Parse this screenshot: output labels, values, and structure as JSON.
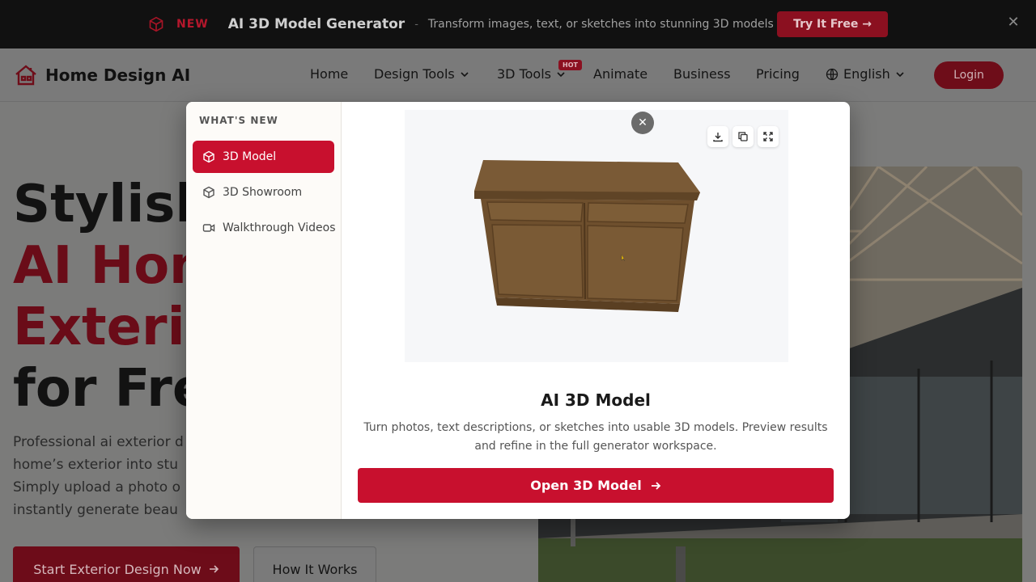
{
  "banner": {
    "new_label": "NEW",
    "title": "AI 3D Model Generator",
    "separator": "-",
    "description": "Transform images, text, or sketches into stunning 3D models",
    "cta": "Try It Free →",
    "close": "✕"
  },
  "nav": {
    "brand": "Home Design AI",
    "items": [
      "Home",
      "Design Tools",
      "3D Tools",
      "Animate",
      "Business",
      "Pricing"
    ],
    "hot_badge": "HOT",
    "language": "English",
    "login": "Login"
  },
  "hero": {
    "line1": "Stylish",
    "line2": "AI Hom",
    "line3": "Exterio",
    "line4": "for Fre",
    "para": [
      "Professional ai exterior d",
      "home’s exterior into stu",
      "Simply upload a photo o",
      "instantly generate beau"
    ],
    "primary_cta": "Start Exterior Design Now",
    "secondary_cta": "How It Works"
  },
  "modal": {
    "section_title": "WHAT'S NEW",
    "side_items": [
      "3D Model",
      "3D Showroom",
      "Walkthrough Videos"
    ],
    "active_index": 0,
    "title": "AI 3D Model",
    "description": "Turn photos, text descriptions, or sketches into usable 3D models. Preview results and refine in the full generator workspace.",
    "cta": "Open 3D Model",
    "close": "✕"
  },
  "colors": {
    "accent": "#c8102e",
    "banner_bg": "#111111"
  }
}
